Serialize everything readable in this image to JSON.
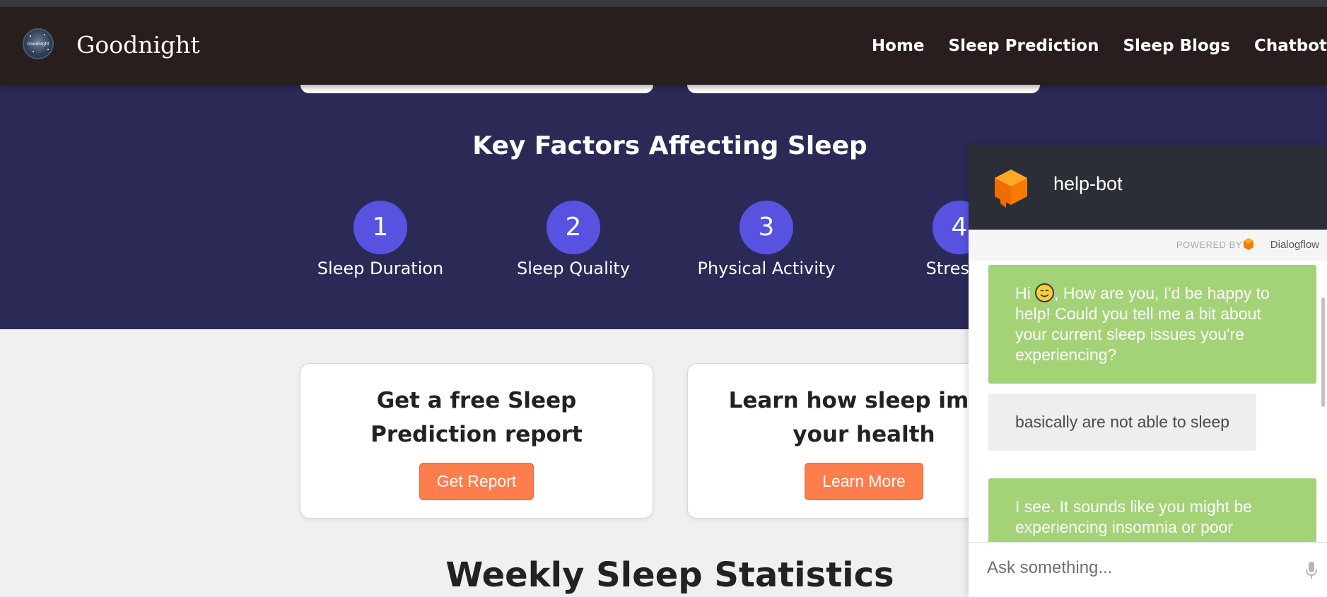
{
  "brand": {
    "name": "Goodnight",
    "logo_text": "Goodnight"
  },
  "nav": {
    "items": [
      "Home",
      "Sleep Prediction",
      "Sleep Blogs",
      "Chatbot"
    ]
  },
  "key_factors": {
    "title": "Key Factors Affecting Sleep",
    "items": [
      {
        "number": "1",
        "label": "Sleep Duration"
      },
      {
        "number": "2",
        "label": "Sleep Quality"
      },
      {
        "number": "3",
        "label": "Physical Activity"
      },
      {
        "number": "4",
        "label": "Stress L"
      }
    ]
  },
  "cards": [
    {
      "title": "Get a free Sleep Prediction report",
      "button": "Get Report"
    },
    {
      "title": "Learn how sleep impa your health",
      "button": "Learn More"
    }
  ],
  "stats": {
    "title": "Weekly Sleep Statistics"
  },
  "chat": {
    "bot_name": "help-bot",
    "powered_by": "POWERED BY",
    "provider": "Dialogflow",
    "messages": [
      {
        "from": "bot",
        "before_emoji": "Hi ",
        "after_emoji": ", How are you, I'd be happy to help! Could you tell me a bit about your current sleep issues you're experiencing?"
      },
      {
        "from": "user",
        "text": "basically are not able to sleep"
      },
      {
        "from": "bot",
        "text": "I see. It sounds like you might be experiencing insomnia or poor"
      }
    ],
    "input_placeholder": "Ask something..."
  },
  "colors": {
    "navbar": "#281e1e",
    "band": "#2b2a57",
    "factor_circle": "#5753e0",
    "button": "#fd7d4d",
    "bot_bubble": "#a4d277",
    "user_bubble": "#eeeeee",
    "chat_header": "#2b2e37"
  }
}
